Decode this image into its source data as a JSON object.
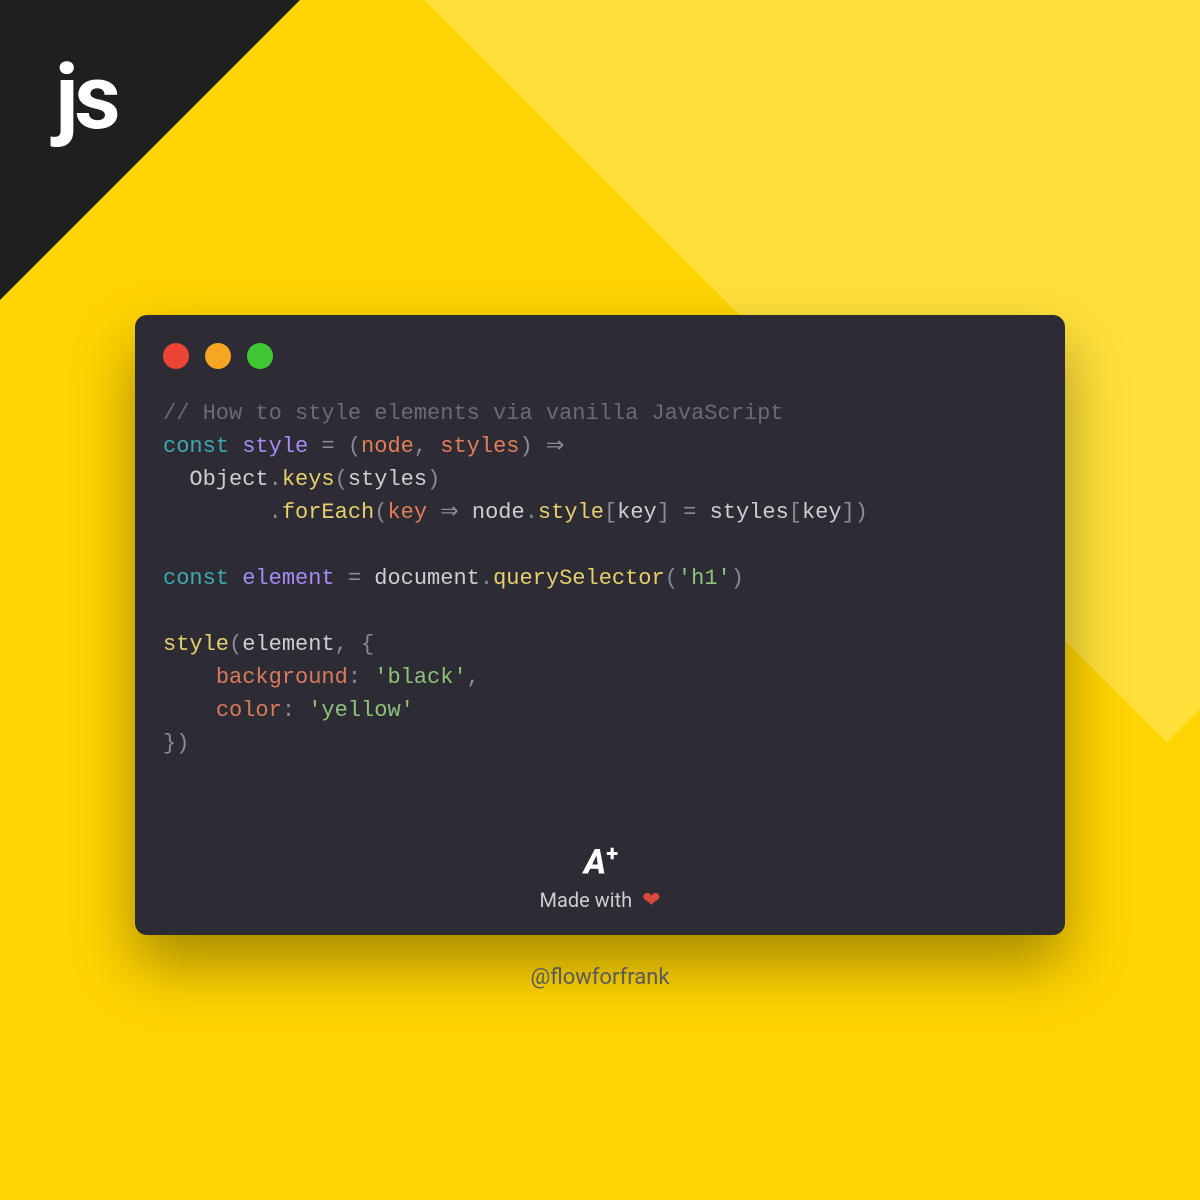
{
  "corner_label": "js",
  "code": {
    "comment": "// How to style elements via vanilla JavaScript",
    "kw_const": "const",
    "fn_style": "style",
    "p_node": "node",
    "p_styles": "styles",
    "obj_Object": "Object",
    "m_keys": "keys",
    "m_forEach": "forEach",
    "p_key": "key",
    "prop_style": "style",
    "var_element": "element",
    "obj_document": "document",
    "m_querySelector": "querySelector",
    "str_h1": "'h1'",
    "lit_background": "background",
    "str_black": "'black'",
    "lit_color": "color",
    "str_yellow": "'yellow'"
  },
  "footer": {
    "logo_text": "A",
    "logo_plus": "+",
    "made_with": "Made with",
    "heart": "❤"
  },
  "handle": "@flowforfrank"
}
